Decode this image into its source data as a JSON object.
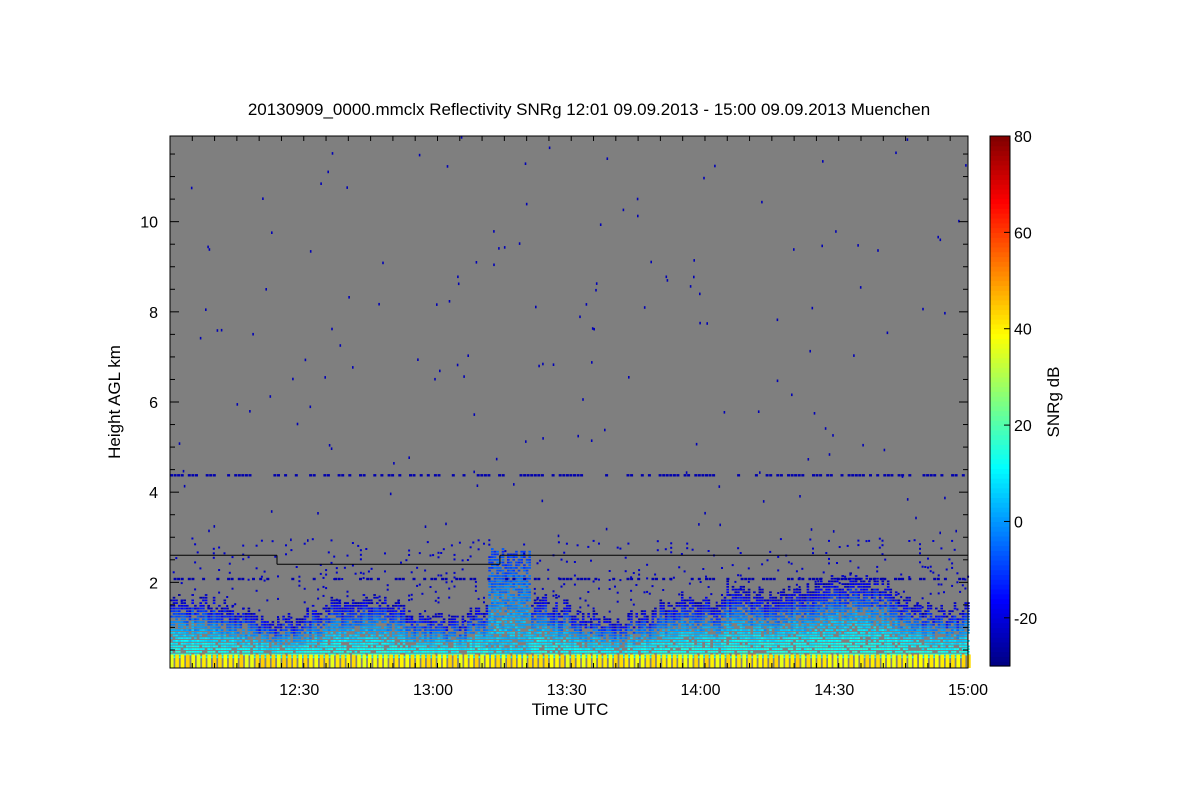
{
  "chart_data": {
    "type": "heatmap",
    "title": "20130909_0000.mmclx Reflectivity SNRg   12:01 09.09.2013 - 15:00 09.09.2013 Muenchen",
    "xlabel": "Time UTC",
    "ylabel": "Height AGL km",
    "colorbar_label": "SNRg dB",
    "x_range": [
      "12:01",
      "15:00"
    ],
    "x_ticks": [
      "12:30",
      "13:00",
      "13:30",
      "14:00",
      "14:30",
      "15:00"
    ],
    "y_range": [
      0.1,
      11.9
    ],
    "y_ticks": [
      "2",
      "4",
      "6",
      "8",
      "10"
    ],
    "colorbar_range": [
      -30,
      80
    ],
    "colorbar_ticks": [
      "-20",
      "0",
      "20",
      "40",
      "60",
      "80"
    ],
    "background_color": "#7f7f7f",
    "colormap": "jet",
    "reference_line": [
      {
        "from": "12:01",
        "to": "12:25",
        "height_km": 2.6
      },
      {
        "from": "12:25",
        "to": "13:15",
        "height_km": 2.4
      },
      {
        "from": "13:15",
        "to": "15:00",
        "height_km": 2.6
      }
    ],
    "features": [
      {
        "name": "surface clutter",
        "height_km": [
          0.1,
          0.4
        ],
        "snr_db": 40
      },
      {
        "name": "boundary layer echo",
        "height_km": [
          0.4,
          1.2
        ],
        "snr_db": 5
      },
      {
        "name": "convective plume",
        "time": [
          "13:12",
          "13:22"
        ],
        "height_km": [
          0.1,
          2.8
        ],
        "snr_db": 10
      },
      {
        "name": "noise band",
        "height_km": 4.4,
        "snr_db": -25
      },
      {
        "name": "noise band",
        "height_km": 2.1,
        "snr_db": -25
      }
    ]
  }
}
